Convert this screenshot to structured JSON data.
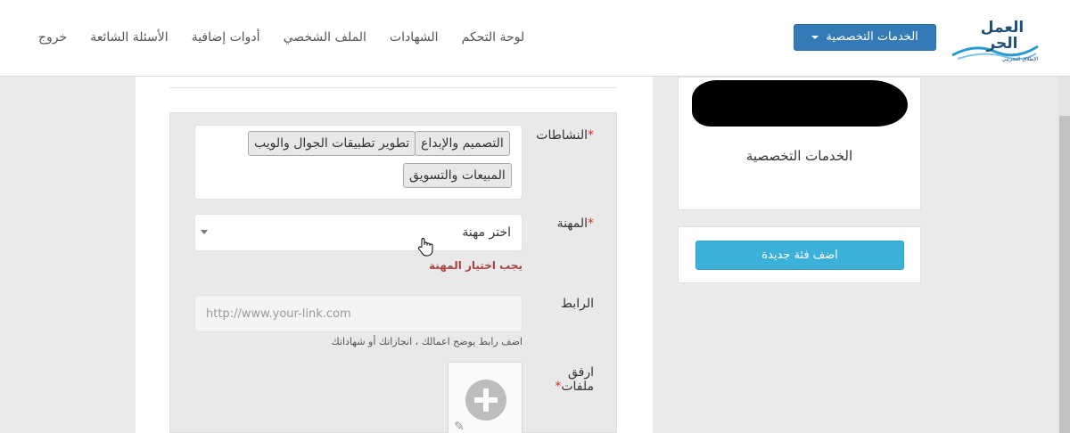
{
  "nav": {
    "links": [
      "لوحة التحكم",
      "الشهادات",
      "الملف الشخصي",
      "أدوات إضافية",
      "الأسئلة الشائعة",
      "خروج"
    ],
    "services_label": "الخدمات التخصصية",
    "logo_text_1": "العمل",
    "logo_text_2": "الحر",
    "logo_sub": "الإطلاق التجريبي"
  },
  "form": {
    "activities_label": "النشاطات",
    "activities_tags": [
      "التصميم والإبداع",
      "تطوير تطبيقات الجوال والويب",
      "المبيعات والتسويق"
    ],
    "job_label": "المهنة",
    "job_selected": "اختر مهنة",
    "job_error": "يجب اختيار المهنة",
    "link_label": "الرابط",
    "link_placeholder": "http://www.your-link.com",
    "link_help": "اضف رابط يوضح اعمالك ، انجازاتك أو شهاداتك",
    "attach_label_1": "ارفق",
    "attach_label_2": "ملفات"
  },
  "sidebar": {
    "title": "الخدمات التخصصية",
    "add_button": "اضف فئة جديدة"
  },
  "colors": {
    "primary": "#337ab7",
    "info": "#3bb0d8",
    "error": "#a94442",
    "required": "#c9302c"
  }
}
